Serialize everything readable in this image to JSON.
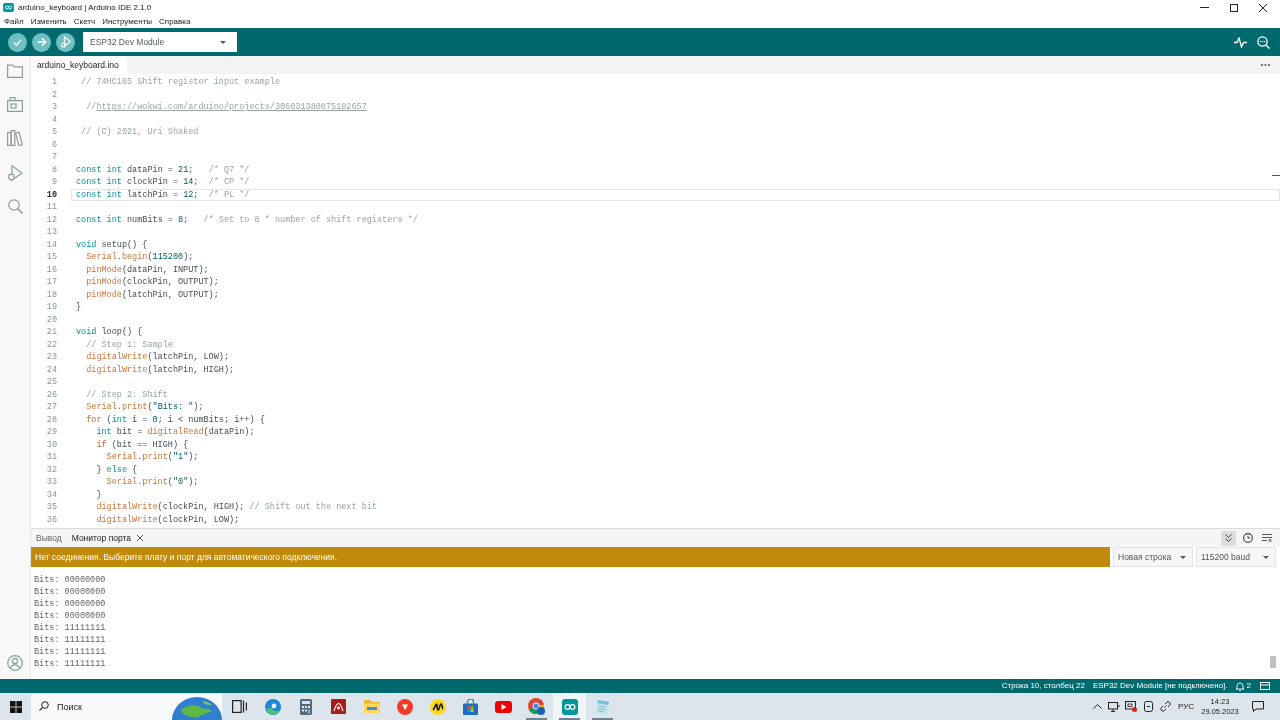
{
  "window": {
    "title": "arduino_keyboard | Arduino IDE 2.1.0"
  },
  "menu": [
    "Файл",
    "Изменить",
    "Скетч",
    "Инструменты",
    "Справка"
  ],
  "toolbar": {
    "board": "ESP32 Dev Module"
  },
  "editor": {
    "tabs": [
      {
        "label": "arduino_keyboard.ino",
        "selected": true
      }
    ],
    "lines": [
      {
        "number": "1",
        "current": false,
        "tokens": [
          {
            "kind": "comment",
            "text": " // 74HC165 Shift register input example"
          }
        ]
      },
      {
        "number": "2",
        "current": false
      },
      {
        "number": "3",
        "current": false,
        "tokens": [
          {
            "kind": "comment",
            "text": "  //"
          },
          {
            "kind": "link",
            "text": "https://wokwi.com/arduino/projects/306031380875182657"
          }
        ]
      },
      {
        "number": "4",
        "current": false
      },
      {
        "number": "5",
        "current": false,
        "tokens": [
          {
            "kind": "comment",
            "text": " // (C) 2021, Uri Shaked"
          }
        ]
      },
      {
        "number": "6",
        "current": false
      },
      {
        "number": "7",
        "current": false
      },
      {
        "number": "8",
        "current": false,
        "tokens": [
          {
            "kind": "keyword",
            "text": "const int"
          },
          {
            "kind": "plain",
            "text": " dataPin = "
          },
          {
            "kind": "number",
            "text": "21"
          },
          {
            "kind": "plain",
            "text": ";   "
          },
          {
            "kind": "comment",
            "text": "/* Q7 */"
          }
        ]
      },
      {
        "number": "9",
        "current": false,
        "tokens": [
          {
            "kind": "keyword",
            "text": "const int"
          },
          {
            "kind": "plain",
            "text": " clockPin = "
          },
          {
            "kind": "number",
            "text": "14"
          },
          {
            "kind": "plain",
            "text": ";  "
          },
          {
            "kind": "comment",
            "text": "/* CP */"
          }
        ]
      },
      {
        "number": "10",
        "current": true,
        "tokens": [
          {
            "kind": "keyword",
            "text": "const int"
          },
          {
            "kind": "plain",
            "text": " latchPin = "
          },
          {
            "kind": "number",
            "text": "12"
          },
          {
            "kind": "plain",
            "text": ";  "
          },
          {
            "kind": "comment",
            "text": "/* PL */"
          }
        ]
      },
      {
        "number": "11",
        "current": false
      },
      {
        "number": "12",
        "current": false,
        "tokens": [
          {
            "kind": "keyword",
            "text": "const int"
          },
          {
            "kind": "plain",
            "text": " numBits = "
          },
          {
            "kind": "number",
            "text": "8"
          },
          {
            "kind": "plain",
            "text": ";   "
          },
          {
            "kind": "comment",
            "text": "/* Set to 8 * number of shift registers */"
          }
        ]
      },
      {
        "number": "13",
        "current": false
      },
      {
        "number": "14",
        "current": false,
        "tokens": [
          {
            "kind": "keyword",
            "text": "void"
          },
          {
            "kind": "plain",
            "text": " setup() {"
          }
        ]
      },
      {
        "number": "15",
        "current": false,
        "tokens": [
          {
            "kind": "function",
            "text": "  Serial"
          },
          {
            "kind": "plain",
            "text": "."
          },
          {
            "kind": "function",
            "text": "begin"
          },
          {
            "kind": "plain",
            "text": "("
          },
          {
            "kind": "number",
            "text": "115200"
          },
          {
            "kind": "plain",
            "text": ");"
          }
        ]
      },
      {
        "number": "16",
        "current": false,
        "tokens": [
          {
            "kind": "function",
            "text": "  pinMode"
          },
          {
            "kind": "plain",
            "text": "(dataPin, INPUT);"
          }
        ]
      },
      {
        "number": "17",
        "current": false,
        "tokens": [
          {
            "kind": "function",
            "text": "  pinMode"
          },
          {
            "kind": "plain",
            "text": "(clockPin, OUTPUT);"
          }
        ]
      },
      {
        "number": "18",
        "current": false,
        "tokens": [
          {
            "kind": "function",
            "text": "  pinMode"
          },
          {
            "kind": "plain",
            "text": "(latchPin, OUTPUT);"
          }
        ]
      },
      {
        "number": "19",
        "current": false,
        "tokens": [
          {
            "kind": "plain",
            "text": "}"
          }
        ]
      },
      {
        "number": "20",
        "current": false
      },
      {
        "number": "21",
        "current": false,
        "tokens": [
          {
            "kind": "keyword",
            "text": "void"
          },
          {
            "kind": "plain",
            "text": " loop() {"
          }
        ]
      },
      {
        "number": "22",
        "current": false,
        "tokens": [
          {
            "kind": "comment",
            "text": "  // Step 1: Sample"
          }
        ]
      },
      {
        "number": "23",
        "current": false,
        "tokens": [
          {
            "kind": "function",
            "text": "  digitalWrite"
          },
          {
            "kind": "plain",
            "text": "(latchPin, LOW);"
          }
        ]
      },
      {
        "number": "24",
        "current": false,
        "tokens": [
          {
            "kind": "function",
            "text": "  digitalWrite"
          },
          {
            "kind": "plain",
            "text": "(latchPin, HIGH);"
          }
        ]
      },
      {
        "number": "25",
        "current": false
      },
      {
        "number": "26",
        "current": false,
        "tokens": [
          {
            "kind": "comment",
            "text": "  // Step 2: Shift"
          }
        ]
      },
      {
        "number": "27",
        "current": false,
        "tokens": [
          {
            "kind": "function",
            "text": "  Serial"
          },
          {
            "kind": "plain",
            "text": "."
          },
          {
            "kind": "function",
            "text": "print"
          },
          {
            "kind": "plain",
            "text": "("
          },
          {
            "kind": "string",
            "text": "\"Bits: \""
          },
          {
            "kind": "plain",
            "text": ");"
          }
        ]
      },
      {
        "number": "28",
        "current": false,
        "tokens": [
          {
            "kind": "control",
            "text": "  for"
          },
          {
            "kind": "plain",
            "text": " ("
          },
          {
            "kind": "keyword",
            "text": "int"
          },
          {
            "kind": "plain",
            "text": " i = "
          },
          {
            "kind": "number",
            "text": "0"
          },
          {
            "kind": "plain",
            "text": "; i < numBits; i++) {"
          }
        ]
      },
      {
        "number": "29",
        "current": false,
        "tokens": [
          {
            "kind": "keyword",
            "text": "    int"
          },
          {
            "kind": "plain",
            "text": " bit = "
          },
          {
            "kind": "function",
            "text": "digitalRead"
          },
          {
            "kind": "plain",
            "text": "(dataPin);"
          }
        ]
      },
      {
        "number": "30",
        "current": false,
        "tokens": [
          {
            "kind": "control",
            "text": "    if"
          },
          {
            "kind": "plain",
            "text": " (bit == HIGH) {"
          }
        ]
      },
      {
        "number": "31",
        "current": false,
        "tokens": [
          {
            "kind": "function",
            "text": "      Serial"
          },
          {
            "kind": "plain",
            "text": "."
          },
          {
            "kind": "function",
            "text": "print"
          },
          {
            "kind": "plain",
            "text": "("
          },
          {
            "kind": "string",
            "text": "\"1\""
          },
          {
            "kind": "plain",
            "text": ");"
          }
        ]
      },
      {
        "number": "32",
        "current": false,
        "tokens": [
          {
            "kind": "plain",
            "text": "    } "
          },
          {
            "kind": "keyword",
            "text": "else"
          },
          {
            "kind": "plain",
            "text": " {"
          }
        ]
      },
      {
        "number": "33",
        "current": false,
        "tokens": [
          {
            "kind": "function",
            "text": "      Serial"
          },
          {
            "kind": "plain",
            "text": "."
          },
          {
            "kind": "function",
            "text": "print"
          },
          {
            "kind": "plain",
            "text": "("
          },
          {
            "kind": "string",
            "text": "\"0\""
          },
          {
            "kind": "plain",
            "text": ");"
          }
        ]
      },
      {
        "number": "34",
        "current": false,
        "tokens": [
          {
            "kind": "plain",
            "text": "    }"
          }
        ]
      },
      {
        "number": "35",
        "current": false,
        "tokens": [
          {
            "kind": "function",
            "text": "    digitalWrite"
          },
          {
            "kind": "plain",
            "text": "(clockPin, HIGH); "
          },
          {
            "kind": "comment",
            "text": "// Shift out the next bit"
          }
        ]
      },
      {
        "number": "36",
        "current": false,
        "tokens": [
          {
            "kind": "function",
            "text": "    digitalWrite"
          },
          {
            "kind": "plain",
            "text": "(clockPin, LOW);"
          }
        ]
      }
    ]
  },
  "panel": {
    "tabs": [
      {
        "label": "Вывод",
        "selected": false,
        "closable": false
      },
      {
        "label": "Монитор порта",
        "selected": true,
        "closable": true
      }
    ],
    "autoscroll": true,
    "message": "Нет соединения. Выберите плату и порт для автоматического подключения.",
    "line_ending": "Новая строка",
    "baud": "115200 baud",
    "output": [
      "Bits: 00000000",
      "Bits: 00000000",
      "Bits: 00000000",
      "Bits: 00000000",
      "Bits: 11111111",
      "Bits: 11111111",
      "Bits: 11111111",
      "Bits: 11111111"
    ]
  },
  "status_bar": {
    "position": "Строка 10, столбец 22",
    "board": "ESP32 Dev Module [не подключено].",
    "notifications": "2"
  },
  "taskbar": {
    "search": {
      "placeholder": "Поиск"
    },
    "apps": [
      {
        "kind": "task_view",
        "active": false,
        "open": false
      },
      {
        "kind": "browser_swirl",
        "active": false,
        "open": false
      },
      {
        "kind": "calculator",
        "active": false,
        "open": false
      },
      {
        "kind": "red_tile",
        "active": false,
        "open": false
      },
      {
        "kind": "folder",
        "active": false,
        "open": false
      },
      {
        "kind": "red_disc",
        "active": false,
        "open": false
      },
      {
        "kind": "yellow_disc",
        "active": false,
        "open": false
      },
      {
        "kind": "store",
        "active": false,
        "open": false
      },
      {
        "kind": "video",
        "active": false,
        "open": false
      },
      {
        "kind": "browser_ring",
        "active": false,
        "open": true
      },
      {
        "kind": "infinity",
        "active": true,
        "open": true
      },
      {
        "kind": "notepad",
        "active": false,
        "open": true
      }
    ],
    "language": "РУС",
    "time": "14:23",
    "date": "29.05.2023"
  }
}
